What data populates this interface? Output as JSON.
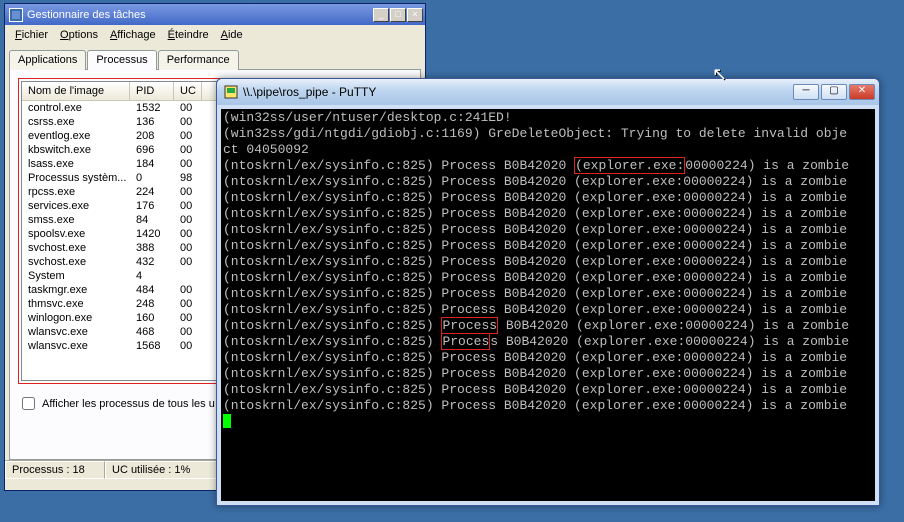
{
  "taskmgr": {
    "title": "Gestionnaire des tâches",
    "menus": [
      {
        "u": "F",
        "rest": "ichier"
      },
      {
        "u": "O",
        "rest": "ptions"
      },
      {
        "u": "A",
        "rest": "ffichage"
      },
      {
        "u": "É",
        "rest": "teindre"
      },
      {
        "u": "A",
        "rest": "ide"
      }
    ],
    "tabs": [
      "Applications",
      "Processus",
      "Performance"
    ],
    "active_tab": 1,
    "columns": {
      "name": "Nom de l'image",
      "pid": "PID",
      "uc": "UC"
    },
    "rows": [
      {
        "name": "control.exe",
        "pid": "1532",
        "uc": "00"
      },
      {
        "name": "csrss.exe",
        "pid": "136",
        "uc": "00"
      },
      {
        "name": "eventlog.exe",
        "pid": "208",
        "uc": "00"
      },
      {
        "name": "kbswitch.exe",
        "pid": "696",
        "uc": "00"
      },
      {
        "name": "lsass.exe",
        "pid": "184",
        "uc": "00"
      },
      {
        "name": "Processus systèm...",
        "pid": "0",
        "uc": "98"
      },
      {
        "name": "rpcss.exe",
        "pid": "224",
        "uc": "00"
      },
      {
        "name": "services.exe",
        "pid": "176",
        "uc": "00"
      },
      {
        "name": "smss.exe",
        "pid": "84",
        "uc": "00"
      },
      {
        "name": "spoolsv.exe",
        "pid": "1420",
        "uc": "00"
      },
      {
        "name": "svchost.exe",
        "pid": "388",
        "uc": "00"
      },
      {
        "name": "svchost.exe",
        "pid": "432",
        "uc": "00"
      },
      {
        "name": "System",
        "pid": "4",
        "uc": ""
      },
      {
        "name": "taskmgr.exe",
        "pid": "484",
        "uc": "00"
      },
      {
        "name": "thmsvc.exe",
        "pid": "248",
        "uc": "00"
      },
      {
        "name": "winlogon.exe",
        "pid": "160",
        "uc": "00"
      },
      {
        "name": "wlansvc.exe",
        "pid": "468",
        "uc": "00"
      },
      {
        "name": "wlansvc.exe",
        "pid": "1568",
        "uc": "00"
      }
    ],
    "show_all": "Afficher les processus de tous les u",
    "status": {
      "procs": "Processus : 18",
      "uc": "UC utilisée :    1%"
    }
  },
  "putty": {
    "title": "\\\\.\\pipe\\ros_pipe - PuTTY",
    "term_lines": [
      "(win32ss/user/ntuser/desktop.c:241ED!",
      "(win32ss/gdi/ntgdi/gdiobj.c:1169) GreDeleteObject: Trying to delete invalid obje",
      "ct 04050092",
      "(ntoskrnl/ex/sysinfo.c:825) Process B0B42020 |(explorer.exe:|00000224) is a zombie",
      "(ntoskrnl/ex/sysinfo.c:825) Process B0B42020 (explorer.exe:00000224) is a zombie",
      "(ntoskrnl/ex/sysinfo.c:825) Process B0B42020 (explorer.exe:00000224) is a zombie",
      "(ntoskrnl/ex/sysinfo.c:825) Process B0B42020 (explorer.exe:00000224) is a zombie",
      "(ntoskrnl/ex/sysinfo.c:825) Process B0B42020 (explorer.exe:00000224) is a zombie",
      "(ntoskrnl/ex/sysinfo.c:825) Process B0B42020 (explorer.exe:00000224) is a zombie",
      "(ntoskrnl/ex/sysinfo.c:825) Process B0B42020 (explorer.exe:00000224) is a zombie",
      "(ntoskrnl/ex/sysinfo.c:825) Process B0B42020 (explorer.exe:00000224) is a zombie",
      "(ntoskrnl/ex/sysinfo.c:825) Process B0B42020 (explorer.exe:00000224) is a zombie",
      "(ntoskrnl/ex/sysinfo.c:825) Process B0B42020 (explorer.exe:00000224) is a zombie",
      "(ntoskrnl/ex/sysinfo.c:825) |Process| B0B42020 (explorer.exe:00000224) is a zombie",
      "(ntoskrnl/ex/sysinfo.c:825) |Proces|s B0B42020 (explorer.exe:00000224) is a zombie",
      "(ntoskrnl/ex/sysinfo.c:825) Process B0B42020 (explorer.exe:00000224) is a zombie",
      "(ntoskrnl/ex/sysinfo.c:825) Process B0B42020 (explorer.exe:00000224) is a zombie",
      "(ntoskrnl/ex/sysinfo.c:825) Process B0B42020 (explorer.exe:00000224) is a zombie",
      "(ntoskrnl/ex/sysinfo.c:825) Process B0B42020 (explorer.exe:00000224) is a zombie"
    ]
  }
}
